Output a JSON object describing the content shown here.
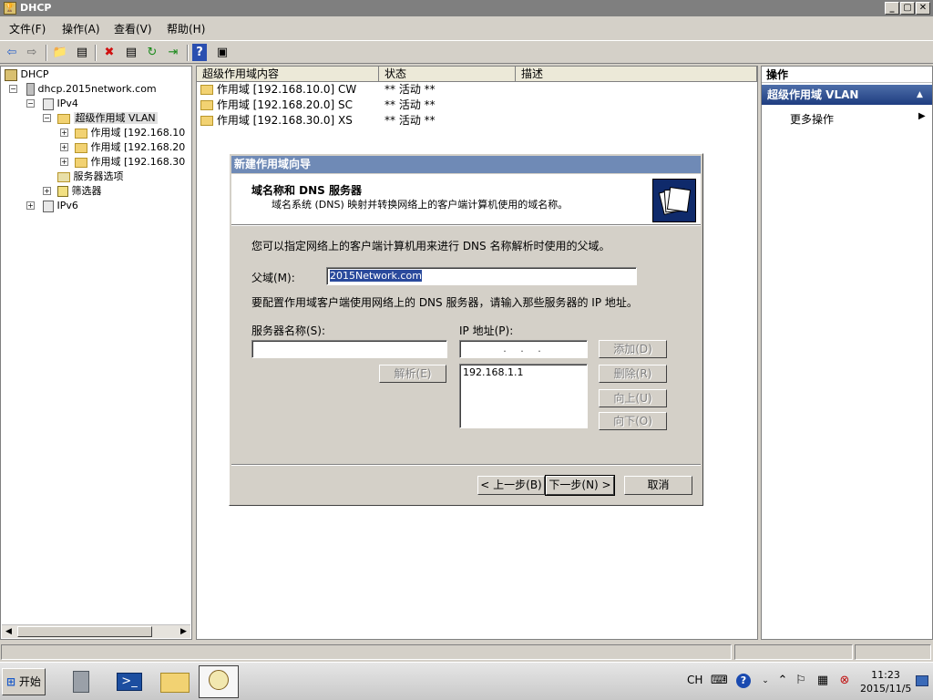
{
  "window": {
    "title": "DHCP",
    "app_icon_glyph": "🏆",
    "min": "_",
    "max": "▢",
    "close": "✕"
  },
  "menu": [
    {
      "label": "文件(F)"
    },
    {
      "label": "操作(A)"
    },
    {
      "label": "查看(V)"
    },
    {
      "label": "帮助(H)"
    }
  ],
  "toolbar": {
    "back": "⇦",
    "forward": "⇨",
    "up": "📁",
    "show_hide": "▤",
    "delete": "✖",
    "properties": "▤",
    "refresh": "↻",
    "export": "⇥",
    "help": "?",
    "view": "▣"
  },
  "tree": {
    "root": "DHCP",
    "server": "dhcp.2015network.com",
    "ipv4": "IPv4",
    "superscope": "超级作用域 VLAN",
    "scopes": [
      "作用域 [192.168.10",
      "作用域 [192.168.20",
      "作用域 [192.168.30"
    ],
    "server_options": "服务器选项",
    "filters": "筛选器",
    "ipv6": "IPv6"
  },
  "list": {
    "columns": [
      "超级作用域内容",
      "状态",
      "描述"
    ],
    "rows": [
      {
        "name": "作用域 [192.168.10.0] CW",
        "status": "** 活动 **",
        "desc": ""
      },
      {
        "name": "作用域 [192.168.20.0] SC",
        "status": "** 活动 **",
        "desc": ""
      },
      {
        "name": "作用域 [192.168.30.0] XS",
        "status": "** 活动 **",
        "desc": ""
      }
    ]
  },
  "actions": {
    "header": "操作",
    "selected": "超级作用域 VLAN",
    "more": "更多操作",
    "more_arrow": "▶",
    "collapse_arrow": "▲"
  },
  "dialog": {
    "title": "新建作用域向导",
    "heading": "域名称和 DNS 服务器",
    "subheading": "域名系统 (DNS) 映射并转换网络上的客户端计算机使用的域名称。",
    "intro": "您可以指定网络上的客户端计算机用来进行 DNS 名称解析时使用的父域。",
    "parent_label": "父域(M):",
    "parent_value": "2015Network.com",
    "configure_text": "要配置作用域客户端使用网络上的 DNS 服务器，请输入那些服务器的 IP 地址。",
    "server_name_label": "服务器名称(S):",
    "server_name_value": "",
    "ip_label": "IP 地址(P):",
    "ip_placeholder": ".   .   .",
    "resolve": "解析(E)",
    "add": "添加(D)",
    "remove": "删除(R)",
    "up": "向上(U)",
    "down": "向下(O)",
    "ip_list": [
      "192.168.1.1"
    ],
    "back": "< 上一步(B)",
    "next": "下一步(N) >",
    "cancel": "取消"
  },
  "taskbar": {
    "start": "开始",
    "lang": "CH",
    "time": "11:23",
    "date": "2015/11/5",
    "help_glyph": "?",
    "up_glyph": "⌃"
  },
  "colors": {
    "title_bar": "#7f7f7f",
    "dialog_title": "#6f8ab6",
    "action_selected": "#2a4a8c",
    "folder": "#f2d272"
  }
}
